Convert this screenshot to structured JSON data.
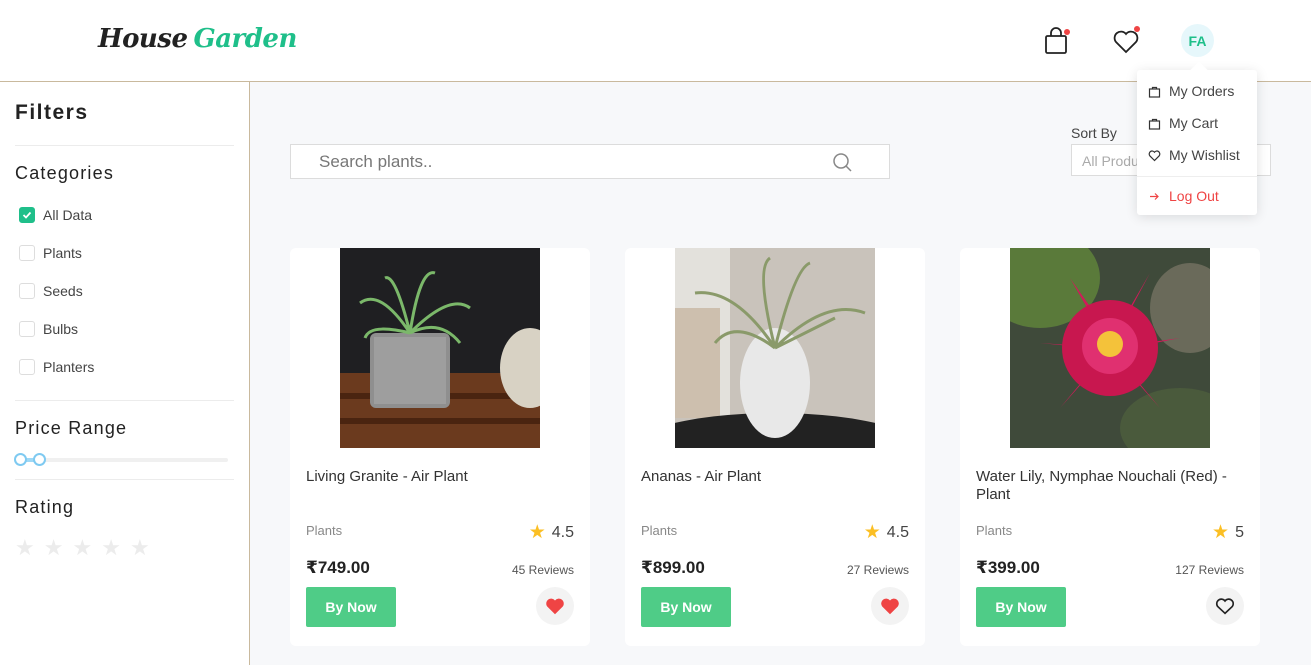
{
  "header": {
    "logo_part1": "House",
    "logo_part2": "Garden",
    "avatar_initials": "FA",
    "cart_icon": "shopping-bag-icon",
    "wishlist_icon": "heart-icon"
  },
  "user_menu": {
    "items": [
      {
        "label": "My Orders",
        "icon": "bag-icon"
      },
      {
        "label": "My Cart",
        "icon": "bag-icon"
      },
      {
        "label": "My Wishlist",
        "icon": "heart-icon"
      }
    ],
    "logout_label": "Log Out"
  },
  "sidebar": {
    "title": "Filters",
    "categories_heading": "Categories",
    "categories": [
      {
        "label": "All Data",
        "checked": true
      },
      {
        "label": "Plants",
        "checked": false
      },
      {
        "label": "Seeds",
        "checked": false
      },
      {
        "label": "Bulbs",
        "checked": false
      },
      {
        "label": "Planters",
        "checked": false
      }
    ],
    "price_heading": "Price Range",
    "rating_heading": "Rating",
    "rating_selected": 0,
    "rating_max": 5
  },
  "search": {
    "placeholder": "Search plants.."
  },
  "sort": {
    "label": "Sort By",
    "selected": "All Products"
  },
  "products": [
    {
      "title": "Living Granite - Air Plant",
      "category": "Plants",
      "rating": "4.5",
      "price": "₹749.00",
      "reviews": "45 Reviews",
      "buy_label": "By Now",
      "wishlisted": true
    },
    {
      "title": "Ananas - Air Plant",
      "category": "Plants",
      "rating": "4.5",
      "price": "₹899.00",
      "reviews": "27 Reviews",
      "buy_label": "By Now",
      "wishlisted": true
    },
    {
      "title": "Water Lily, Nymphae Nouchali (Red) - Plant",
      "category": "Plants",
      "rating": "5",
      "price": "₹399.00",
      "reviews": "127 Reviews",
      "buy_label": "By Now",
      "wishlisted": false
    }
  ],
  "colors": {
    "brand_green": "#1fbf8a",
    "buy_button": "#4fcc87",
    "heart_red": "#ef4444",
    "star_yellow": "#fbbf24"
  }
}
